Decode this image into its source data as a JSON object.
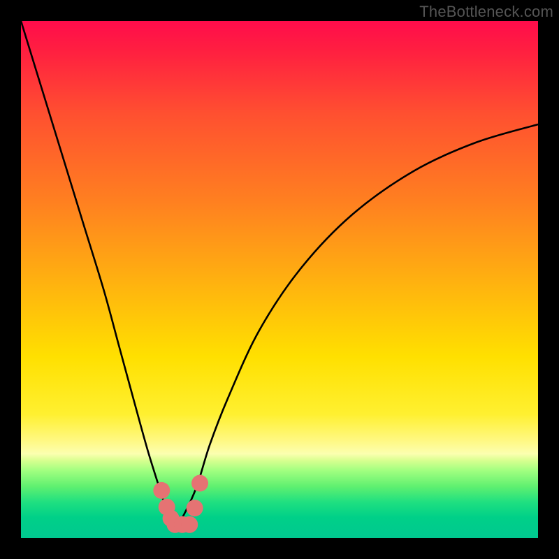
{
  "watermark": "TheBottleneck.com",
  "chart_data": {
    "type": "line",
    "title": "",
    "xlabel": "",
    "ylabel": "",
    "xlim": [
      0,
      100
    ],
    "ylim": [
      0,
      100
    ],
    "series": [
      {
        "name": "bottleneck-curve",
        "x": [
          0,
          4,
          8,
          12,
          16,
          19,
          22,
          24.5,
          27,
          28.5,
          30,
          31.5,
          34,
          36.5,
          40,
          46,
          54,
          64,
          76,
          88,
          100
        ],
        "y": [
          100,
          87,
          74,
          61,
          48,
          37,
          26,
          17,
          9,
          4.5,
          2.5,
          4.5,
          10,
          18,
          27,
          40,
          52,
          62.5,
          71,
          76.5,
          80
        ]
      }
    ],
    "markers": [
      {
        "name": "dot-left-upper",
        "x": 27.2,
        "y": 9.2,
        "r": 1.6
      },
      {
        "name": "dot-left-mid",
        "x": 28.2,
        "y": 6.0,
        "r": 1.6
      },
      {
        "name": "dot-left-lower",
        "x": 29.0,
        "y": 3.8,
        "r": 1.6
      },
      {
        "name": "dot-bottom-a",
        "x": 29.8,
        "y": 2.6,
        "r": 1.6
      },
      {
        "name": "dot-bottom-b",
        "x": 31.2,
        "y": 2.6,
        "r": 1.6
      },
      {
        "name": "dot-bottom-c",
        "x": 32.6,
        "y": 2.6,
        "r": 1.6
      },
      {
        "name": "dot-right-lower",
        "x": 33.6,
        "y": 5.8,
        "r": 1.6
      },
      {
        "name": "dot-right-upper",
        "x": 34.6,
        "y": 10.6,
        "r": 1.6
      }
    ],
    "marker_color": "#e57373",
    "curve_color": "#000000"
  }
}
